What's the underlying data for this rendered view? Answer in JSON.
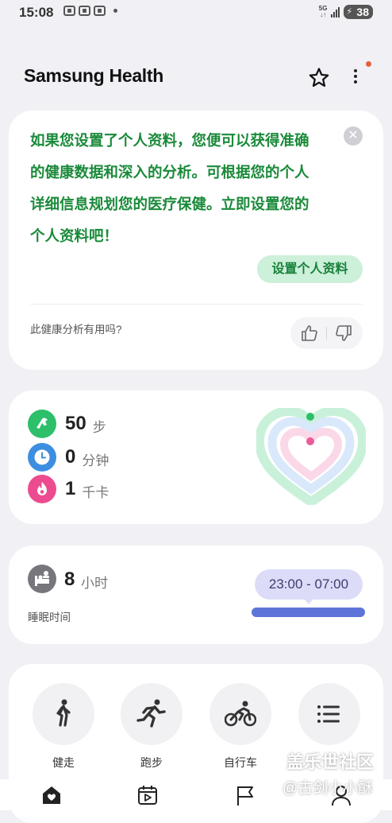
{
  "status_bar": {
    "time": "15:08",
    "network": "5G",
    "battery": "38"
  },
  "header": {
    "title": "Samsung Health"
  },
  "insight_card": {
    "message": "如果您设置了个人资料，您便可以获得准确的健康数据和深入的分析。可根据您的个人详细信息规划您的医疗保健。立即设置您的个人资料吧！",
    "message_lines": [
      "如果您设置了个人资料，您便可以获得准确",
      "的健康数据和深入的分析。可根据您的个人",
      "详细信息规划您的医疗保健。立即设置您的",
      "个人资料吧！"
    ],
    "setup_button": "设置个人资料",
    "feedback_question": "此健康分析有用吗?"
  },
  "activity": {
    "steps": {
      "value": "50",
      "unit": "步"
    },
    "active_time": {
      "value": "0",
      "unit": "分钟"
    },
    "calories": {
      "value": "1",
      "unit": "千卡"
    }
  },
  "sleep": {
    "value": "8",
    "unit": "小时",
    "label": "睡眠时间",
    "range": "23:00 - 07:00"
  },
  "workouts": [
    {
      "label": "健走",
      "icon": "walking-icon"
    },
    {
      "label": "跑步",
      "icon": "running-icon"
    },
    {
      "label": "自行车",
      "icon": "cycling-icon"
    },
    {
      "label": "",
      "icon": "list-icon"
    }
  ],
  "watermark": {
    "line1": "盖乐世社区",
    "line2": "@古剑小小酥"
  },
  "colors": {
    "accent_green": "#1a8a3a",
    "steps": "#2dbf6a",
    "active_time": "#3d8ee0",
    "calories": "#ec4c8f",
    "sleep_bar": "#5f74d9"
  }
}
